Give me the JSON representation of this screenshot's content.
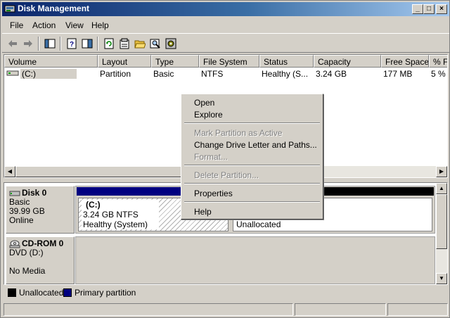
{
  "window": {
    "title": "Disk Management",
    "controls": [
      "_",
      "□",
      "×"
    ]
  },
  "menu": [
    {
      "label": "File"
    },
    {
      "label": "Action"
    },
    {
      "label": "View"
    },
    {
      "label": "Help"
    }
  ],
  "toolbar_icons": [
    "back-arrow-icon",
    "forward-arrow-icon",
    "show-hide-console-tree-icon",
    "help-icon",
    "action-pane-icon",
    "refresh-icon",
    "properties-icon",
    "open-folder-icon",
    "search-icon",
    "disk-settings-icon"
  ],
  "volume_list": {
    "columns": [
      "Volume",
      "Layout",
      "Type",
      "File System",
      "Status",
      "Capacity",
      "Free Space",
      "% Fr"
    ],
    "rows": [
      {
        "volume": "(C:)",
        "layout": "Partition",
        "type": "Basic",
        "file_system": "NTFS",
        "status": "Healthy (S...",
        "capacity": "3.24 GB",
        "free_space": "177 MB",
        "pct_free": "5 %"
      }
    ]
  },
  "disks": [
    {
      "name": "Disk 0",
      "type": "Basic",
      "size": "39.99 GB",
      "state": "Online",
      "partitions": [
        {
          "label": "(C:)",
          "detail": "3.24 GB NTFS",
          "status": "Healthy (System)"
        },
        {
          "label": "Unallocated"
        }
      ]
    },
    {
      "name": "CD-ROM 0",
      "type": "DVD (D:)",
      "state": "No Media"
    }
  ],
  "legend": [
    {
      "label": "Unallocated",
      "color": "#000000"
    },
    {
      "label": "Primary partition",
      "color": "#000080"
    }
  ],
  "context_menu": {
    "items": [
      {
        "label": "Open",
        "enabled": true
      },
      {
        "label": "Explore",
        "enabled": true
      },
      {
        "label": "Mark Partition as Active",
        "enabled": false
      },
      {
        "label": "Change Drive Letter and Paths...",
        "enabled": true
      },
      {
        "label": "Format...",
        "enabled": false
      },
      {
        "label": "Delete Partition...",
        "enabled": false
      },
      {
        "label": "Properties",
        "enabled": true
      },
      {
        "label": "Help",
        "enabled": true
      }
    ]
  },
  "colors": {
    "primary_partition": "#000080",
    "unallocated": "#000000",
    "titlebar": "#0a246a"
  }
}
